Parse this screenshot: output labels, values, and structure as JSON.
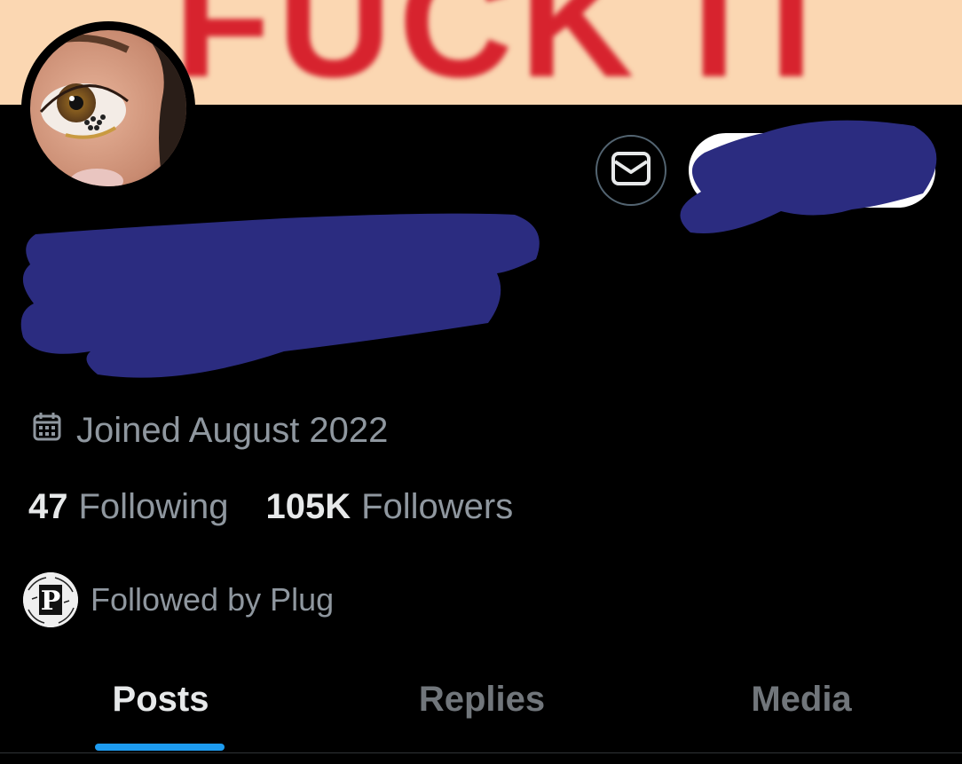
{
  "banner": {
    "text": "FUCK IT",
    "text_color": "#d7232e",
    "background": "#fbd7b2"
  },
  "profile": {
    "joined_text": "Joined August 2022",
    "following_count": "47",
    "following_label": "Following",
    "followers_count": "105K",
    "followers_label": "Followers",
    "followed_by_text": "Followed by Plug",
    "followed_by_initial": "P"
  },
  "tabs": [
    {
      "label": "Posts",
      "active": true
    },
    {
      "label": "Replies",
      "active": false
    },
    {
      "label": "Media",
      "active": false
    }
  ],
  "colors": {
    "background": "#000000",
    "primary_text": "#e7e9ea",
    "secondary_text": "#8f979f",
    "accent": "#1d9bf0",
    "redaction": "#2b2c80"
  },
  "icons": {
    "message": "envelope-icon",
    "joined": "calendar-icon"
  }
}
